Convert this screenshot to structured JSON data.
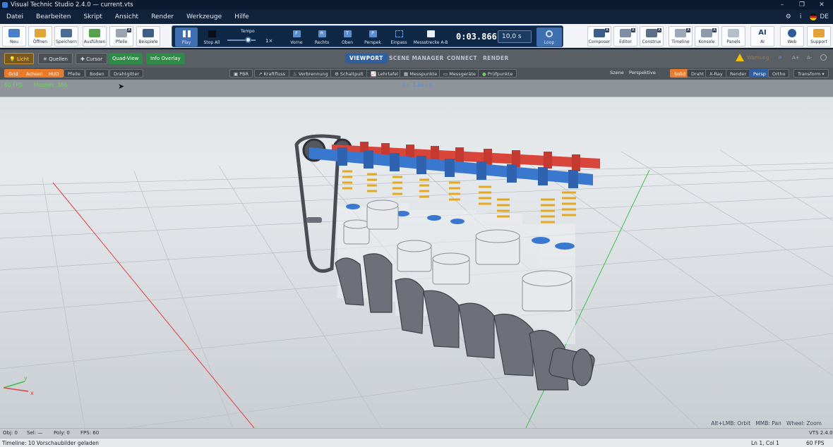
{
  "window": {
    "title": "Visual Technic Studio 2.4.0 — current.vts",
    "min": "–",
    "max": "❐",
    "close": "✕"
  },
  "menu": {
    "items": [
      "Datei",
      "Bearbeiten",
      "Skript",
      "Ansicht",
      "Render",
      "Werkzeuge",
      "Hilfe"
    ],
    "lang": "DE",
    "info": "i"
  },
  "toolbar": {
    "file": [
      {
        "label": "Neu"
      },
      {
        "label": "Öffnen"
      },
      {
        "label": "Speichern"
      },
      {
        "label": "Ausführen"
      },
      {
        "label": "Pfeile"
      },
      {
        "label": "Beispiele"
      }
    ],
    "right": [
      {
        "label": "Composer"
      },
      {
        "label": "Editor"
      },
      {
        "label": "Construx"
      },
      {
        "label": "Timeline"
      },
      {
        "label": "Konsole"
      },
      {
        "label": "Panels"
      },
      {
        "label": "AI",
        "icon": "AI"
      },
      {
        "label": "Web"
      },
      {
        "label": "Support"
      }
    ]
  },
  "transport": {
    "play": "Play",
    "stop": "Stop All",
    "tempo": "Tempo",
    "tempo_mult": "1×",
    "views": [
      "Vorne",
      "Rechts",
      "Oben",
      "Perspek",
      "Einpass",
      "Messstrecke A-B"
    ],
    "view_icons": [
      "F",
      "R",
      "T",
      "P"
    ],
    "timecode": "0:03.866",
    "speed": "10,0 s",
    "loop": "Loop"
  },
  "toolbar2": {
    "licht": "Licht",
    "quellen": "Quellen",
    "cursor": "Cursor",
    "quadview": "Quad-View",
    "info": "Info Overlay",
    "tabs": [
      "VIEWPORT",
      "SCENE MANAGER",
      "CONNECT",
      "RENDER"
    ],
    "warn": "Warnung",
    "ab": [
      "A+",
      "A-"
    ]
  },
  "toolbar3": {
    "left": [
      "Grid",
      "Achsen",
      "HUD",
      "Pfeile",
      "Boden",
      "Drahtgitter"
    ],
    "mid": [
      "PBR",
      "Kraftfluss",
      "Verbrennung",
      "Schaltpult",
      "Lehrtafel",
      "Messpunkte",
      "Messgeräte",
      "Prüfpunkte"
    ],
    "scene": "Szene",
    "persp_label": "Perspektive",
    "modes": [
      "Solid",
      "Draht",
      "X-Ray",
      "Render"
    ],
    "proj": [
      "Persp",
      "Ortho"
    ],
    "transform": "Transform ▾"
  },
  "hud": {
    "fps": "60 FPS",
    "meshes": "Meshes: 386",
    "time": "t = 3.867 s"
  },
  "viewport": {
    "hint": "Alt+LMB: Orbit   MMB: Pan   Wheel: Zoom",
    "version": "VTS 2.4.0",
    "axis_x": "x",
    "axis_y": "y"
  },
  "status": {
    "obj": "Obj: 0",
    "sel": "Sel: —",
    "poly": "Poly: 0",
    "fps": "FPS: 60"
  },
  "footer": {
    "msg": "Timeline: 10 Vorschaubilder geladen",
    "pos": "Ln 1, Col 1",
    "fps": "60 FPS"
  },
  "colors": {
    "accent": "#3e6fb0",
    "orange": "#e97b2a",
    "green": "#2e8b45",
    "cam_red": "#d8453a",
    "cam_blue": "#3a78d0"
  }
}
